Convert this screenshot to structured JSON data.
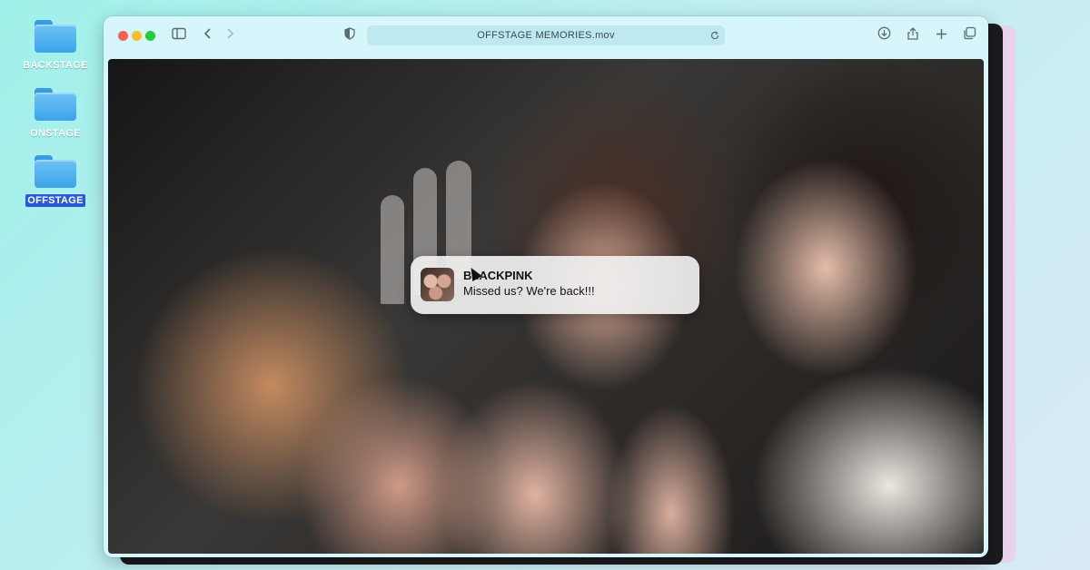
{
  "desktop": {
    "folders": [
      {
        "label": "BACKSTAGE",
        "selected": false
      },
      {
        "label": "ONSTAGE",
        "selected": false
      },
      {
        "label": "OFFSTAGE",
        "selected": true
      }
    ]
  },
  "window": {
    "address": "OFFSTAGE MEMORIES.mov",
    "icons": {
      "sidebar": "sidebar-icon",
      "back": "chevron-left-icon",
      "forward": "chevron-right-icon",
      "privacy": "shield-icon",
      "reload": "reload-icon",
      "download": "download-icon",
      "share": "share-icon",
      "new_tab": "plus-icon",
      "tabs": "tabs-overview-icon"
    }
  },
  "notification": {
    "title": "BLACKPINK",
    "message": "Missed us? We're back!!!"
  },
  "colors": {
    "selection": "#2a5bd7",
    "window_chrome": "#d6f6fb",
    "folder": "#3da4e8"
  }
}
